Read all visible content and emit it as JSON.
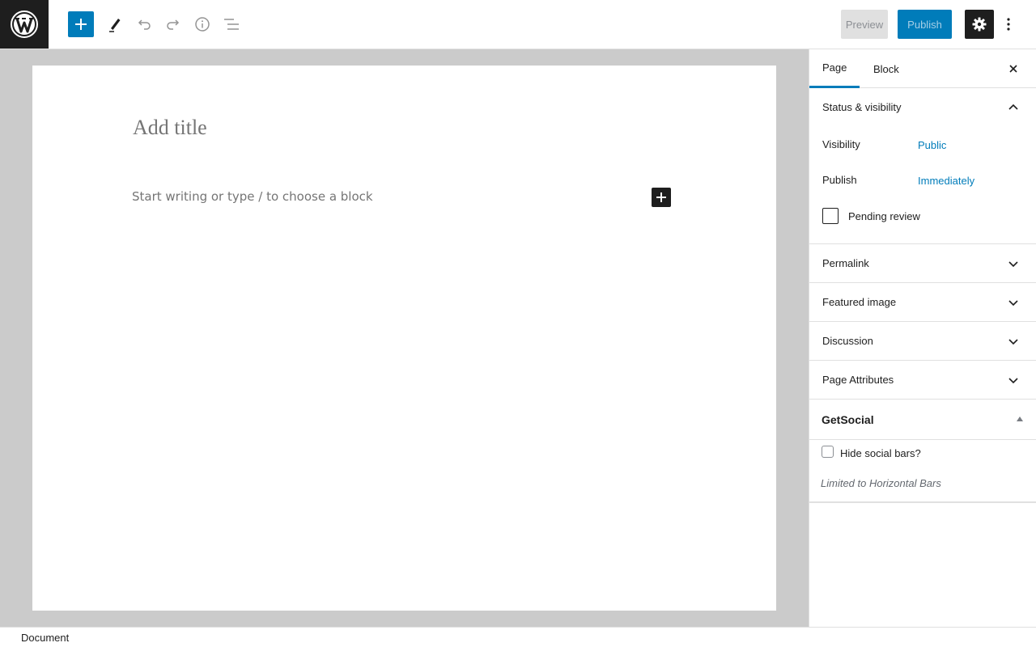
{
  "toolbar": {
    "logo_icon": "wordpress-logo-icon",
    "add_icon": "plus-icon",
    "edit_icon": "pencil-icon",
    "undo_icon": "undo-icon",
    "redo_icon": "redo-icon",
    "info_icon": "info-icon",
    "list_view_icon": "list-view-icon",
    "preview_label": "Preview",
    "publish_label": "Publish",
    "settings_icon": "gear-icon",
    "more_icon": "more-vertical-icon"
  },
  "editor": {
    "title_placeholder": "Add title",
    "block_placeholder": "Start writing or type / to choose a block",
    "inline_add_icon": "plus-icon"
  },
  "sidebar": {
    "tabs": [
      {
        "label": "Page",
        "active": true
      },
      {
        "label": "Block",
        "active": false
      }
    ],
    "close_icon": "close-icon",
    "status_panel": {
      "title": "Status & visibility",
      "visibility_label": "Visibility",
      "visibility_value": "Public",
      "publish_label": "Publish",
      "publish_value": "Immediately",
      "pending_label": "Pending review"
    },
    "panels": [
      {
        "title": "Permalink"
      },
      {
        "title": "Featured image"
      },
      {
        "title": "Discussion"
      },
      {
        "title": "Page Attributes"
      }
    ],
    "getsocial": {
      "title": "GetSocial",
      "checkbox_label": "Hide social bars?",
      "note": "Limited to Horizontal Bars"
    }
  },
  "footer": {
    "label": "Document"
  },
  "colors": {
    "accent": "#007cba",
    "dark": "#1e1e1e",
    "canvas_bg": "#cbcbcb"
  }
}
